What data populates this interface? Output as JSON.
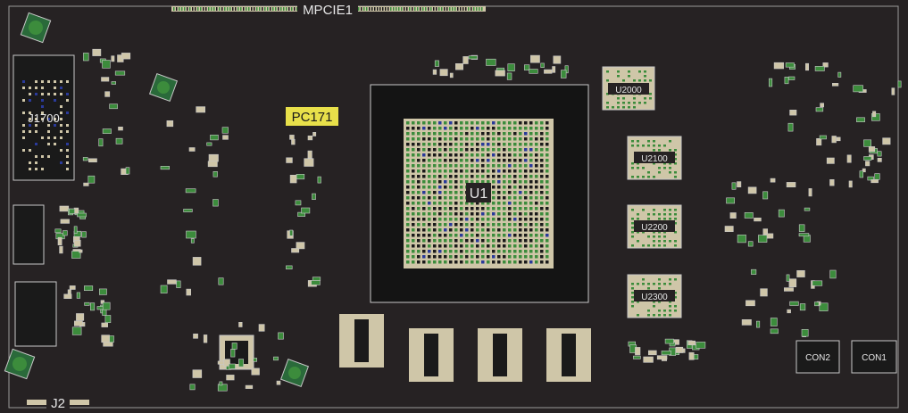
{
  "board": {
    "labels": {
      "mpcie1": "MPCIE1",
      "j1700": "J1700",
      "pc171": "PC171",
      "u1": "U1",
      "u2000": "U2000",
      "u2100": "U2100",
      "u2200": "U2200",
      "u2300": "U2300",
      "con2": "CON2",
      "con1": "CON1",
      "j2": "J2"
    },
    "colors": {
      "background": "#262223",
      "outline": "#c8c8c8",
      "pad_beige": "#cfc6a8",
      "pad_green": "#3c8c3c",
      "via_blue": "#2a3a9a",
      "highlight": "#e8e04a"
    },
    "highlighted_part": "PC171"
  }
}
